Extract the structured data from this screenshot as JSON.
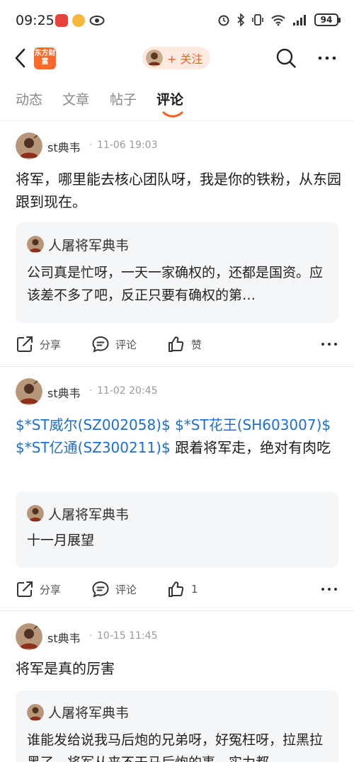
{
  "status_bar": {
    "time": "09:25",
    "battery": "94"
  },
  "header": {
    "logo_text": "东方财富",
    "follow_label": "+ 关注"
  },
  "tabs": [
    {
      "label": "动态",
      "active": false
    },
    {
      "label": "文章",
      "active": false
    },
    {
      "label": "帖子",
      "active": false
    },
    {
      "label": "评论",
      "active": true
    }
  ],
  "posts": [
    {
      "author": "st典韦",
      "time": "11-06 19:03",
      "body": "将军，哪里能去核心团队呀，我是你的铁粉，从东园跟到现在。",
      "quote": {
        "author": "人屠将军典韦",
        "text": "公司真是忙呀，一天一家确权的，还都是国资。应该差不多了吧，反正只要有确权的第…"
      },
      "actions": {
        "share": "分享",
        "comment": "评论",
        "like": "赞"
      }
    },
    {
      "author": "st典韦",
      "time": "11-02 20:45",
      "links": [
        "$*ST威尔(SZ002058)$",
        "$*ST花王(SH603007)$",
        "$*ST亿通(SZ300211)$"
      ],
      "body_tail": "跟着将军走，绝对有肉吃",
      "quote": {
        "author": "人屠将军典韦",
        "text": "十一月展望"
      },
      "actions": {
        "share": "分享",
        "comment": "评论",
        "like": "1"
      }
    },
    {
      "author": "st典韦",
      "time": "10-15 11:45",
      "body": "将军是真的厉害",
      "quote": {
        "author": "人屠将军典韦",
        "text": "谁能发给说我马后炮的兄弟呀，好冤枉呀，拉黑拉黑了，将军从来不干马后炮的事，实力都"
      }
    }
  ]
}
